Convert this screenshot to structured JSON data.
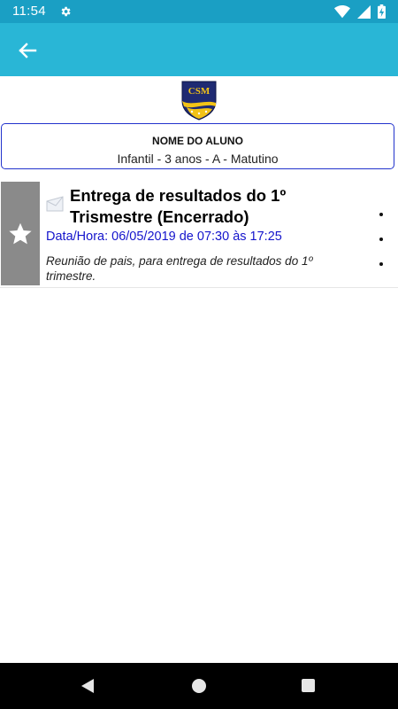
{
  "status_bar": {
    "time": "11:54",
    "icons": [
      "gear-icon",
      "wifi-icon",
      "cell-signal-icon",
      "battery-charging-icon"
    ]
  },
  "app_bar": {
    "back_icon": "arrow-left-icon",
    "color": "#29b6d6"
  },
  "student": {
    "name": "NOME DO ALUNO",
    "class_info": "Infantil - 3 anos - A - Matutino"
  },
  "events": [
    {
      "title": "Entrega de resultados do 1º Trismestre (Encerrado)",
      "date_label": "Data/Hora: 06/05/2019 de 07:30 às 17:25",
      "description": "Reunião de pais, para entrega de resultados do 1º trimestre.",
      "icon": "envelope-icon",
      "side_icon": "star-icon"
    }
  ],
  "nav_bar": {
    "icons": [
      "nav-back-icon",
      "nav-home-icon",
      "nav-recents-icon"
    ]
  }
}
